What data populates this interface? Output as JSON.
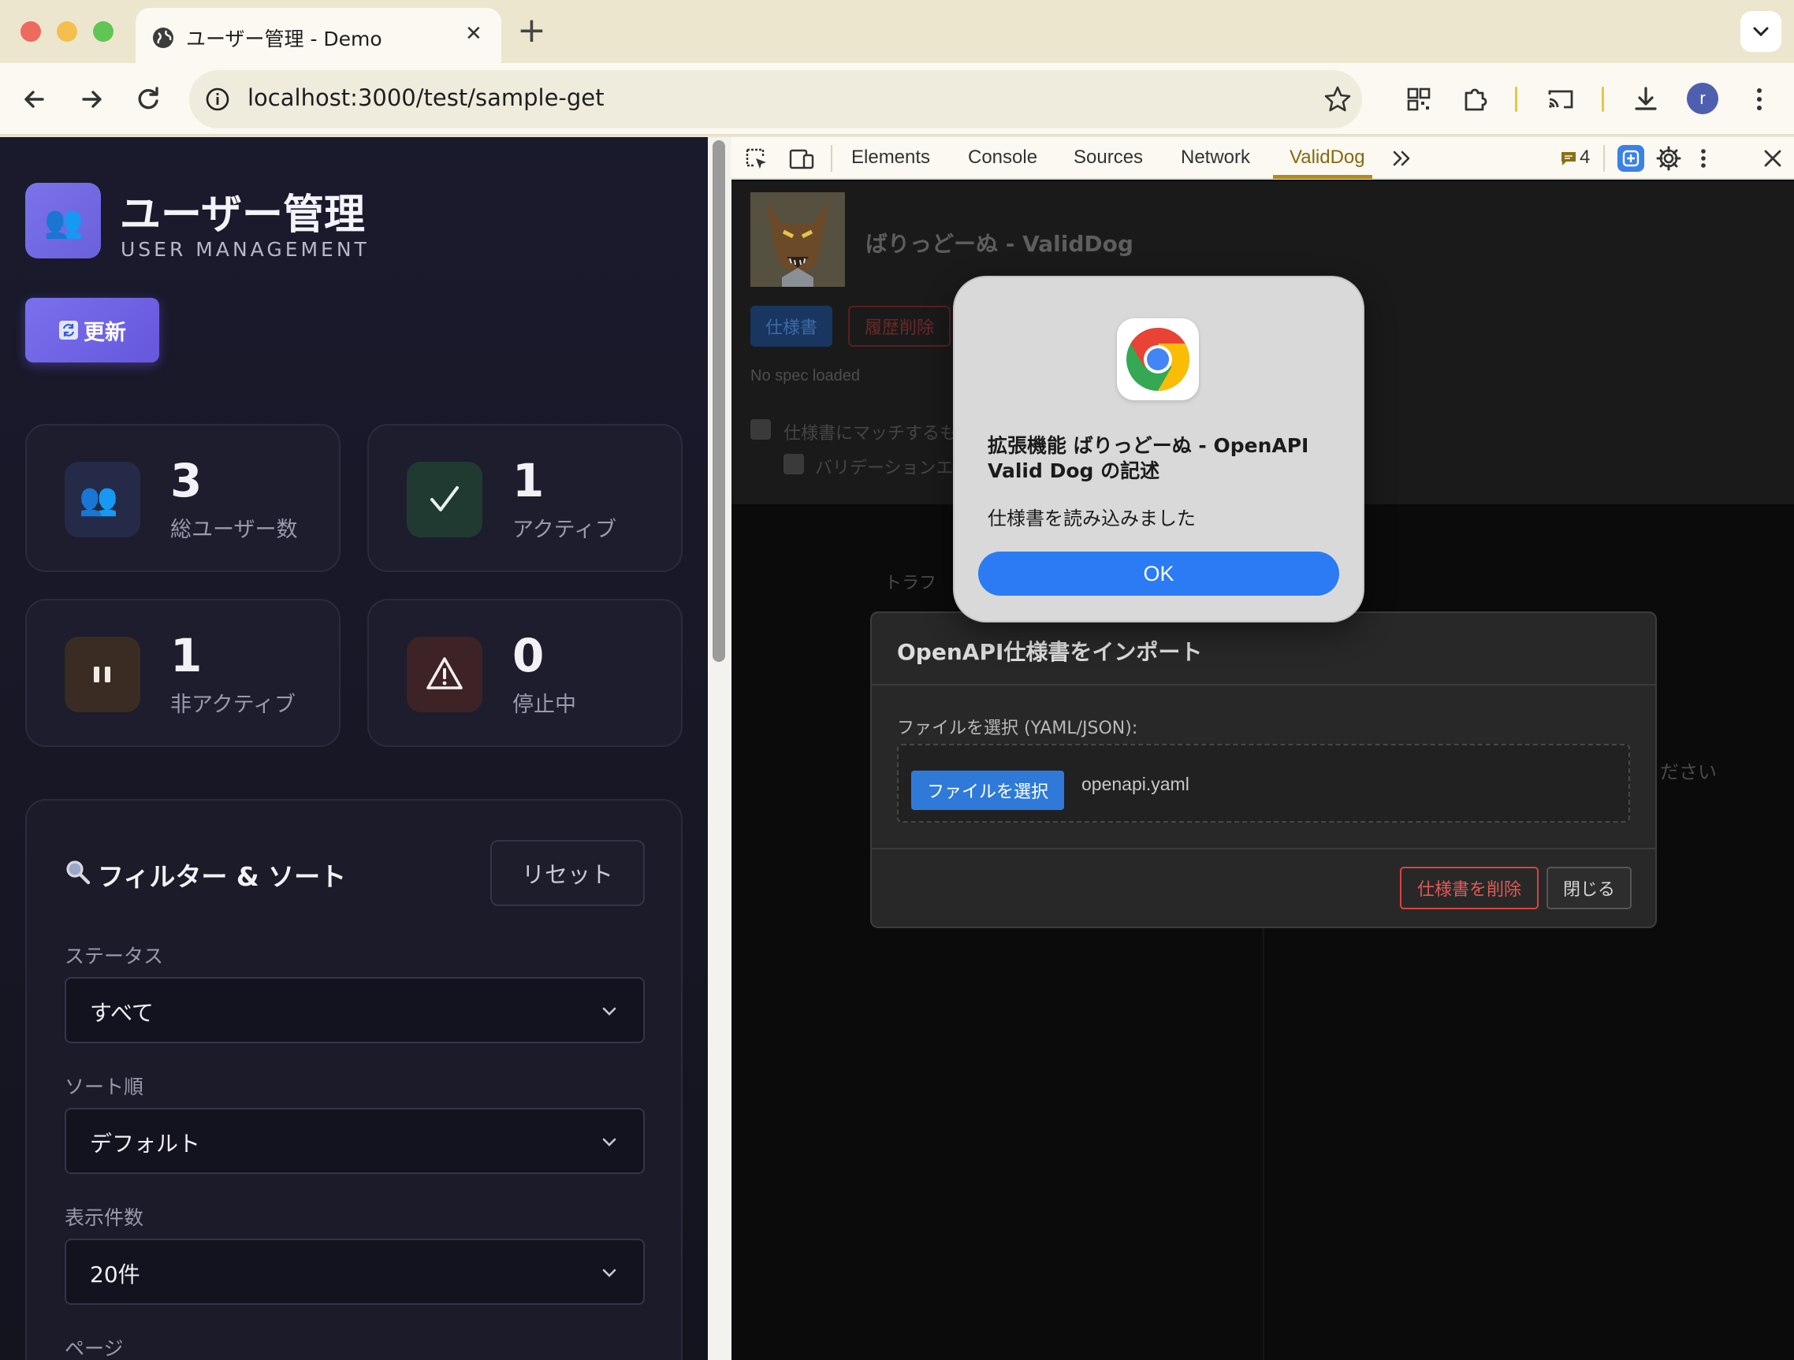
{
  "browser": {
    "tab_title": "ユーザー管理 - Demo",
    "tab_close": "✕",
    "new_tab": "+",
    "url": "localhost:3000/test/sample-get",
    "avatar_initial": "r"
  },
  "page": {
    "title": "ユーザー管理",
    "subtitle": "USER MANAGEMENT",
    "refresh_label": "更新",
    "stats": [
      {
        "value": "3",
        "label": "総ユーザー数",
        "icon": "users-icon"
      },
      {
        "value": "1",
        "label": "アクティブ",
        "icon": "check-icon"
      },
      {
        "value": "1",
        "label": "非アクティブ",
        "icon": "pause-icon"
      },
      {
        "value": "0",
        "label": "停止中",
        "icon": "warning-icon"
      }
    ],
    "filter": {
      "title": "フィルター & ソート",
      "reset_label": "リセット",
      "status_label": "ステータス",
      "status_value": "すべて",
      "sort_label": "ソート順",
      "sort_value": "デフォルト",
      "count_label": "表示件数",
      "count_value": "20件",
      "page_label": "ページ"
    }
  },
  "devtools": {
    "tabs": [
      "Elements",
      "Console",
      "Sources",
      "Network",
      "ValidDog"
    ],
    "active_tab": "ValidDog",
    "issues_count": "4",
    "validdog": {
      "name": "ばりっどーぬ - ValidDog",
      "spec_button": "仕様書",
      "history_delete_button": "履歴削除",
      "no_spec": "No spec loaded",
      "match_checkbox_label": "仕様書にマッチするも",
      "validation_checkbox_label": "バリデーションエ",
      "traffic_text": "トラフ",
      "hint_text": "ださい"
    },
    "import_modal": {
      "title": "OpenAPI仕様書をインポート",
      "file_label": "ファイルを選択 (YAML/JSON):",
      "choose_file_button": "ファイルを選択",
      "file_name": "openapi.yaml",
      "delete_spec_button": "仕様書を削除",
      "close_button": "閉じる"
    }
  },
  "alert": {
    "title": "拡張機能 ばりっどーぬ - OpenAPI Valid Dog の記述",
    "message": "仕様書を読み込みました",
    "ok_label": "OK"
  },
  "colors": {
    "accent": "#7a70ec",
    "alert_ok": "#2a7bf4",
    "danger": "#d9443f",
    "file_button": "#2f7ad8"
  }
}
